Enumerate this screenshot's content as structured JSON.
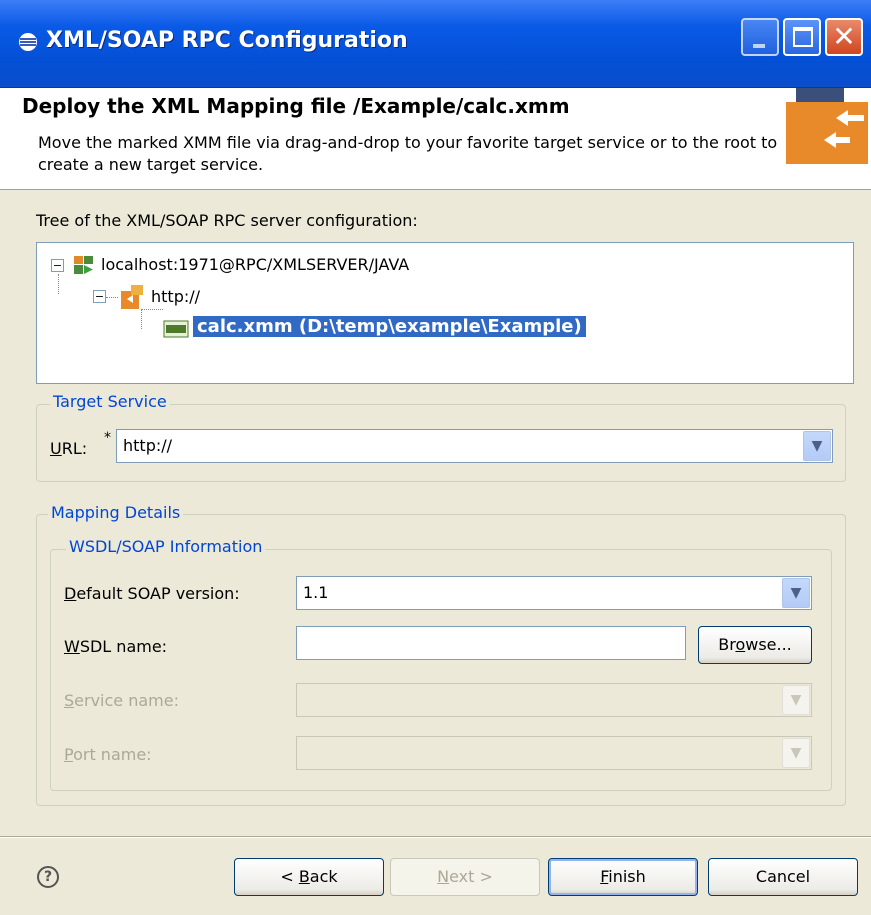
{
  "window": {
    "title": "XML/SOAP RPC Configuration"
  },
  "header": {
    "title": "Deploy the XML Mapping file /Example/calc.xmm",
    "description": "Move the marked XMM file via drag-and-drop to your favorite target service or to the root to create a new target service."
  },
  "tree": {
    "label": "Tree of the XML/SOAP RPC server configuration:",
    "root": "localhost:1971@RPC/XMLSERVER/JAVA",
    "child": "http://",
    "leaf": "calc.xmm (D:\\temp\\example\\Example)"
  },
  "target_service": {
    "group_title": "Target Service",
    "url_label": "URL:",
    "required_mark": "*",
    "url_value": "http://"
  },
  "mapping_details": {
    "group_title": "Mapping Details",
    "wsdl_group_title": "WSDL/SOAP Information",
    "soap_version_label": "Default SOAP version:",
    "soap_version_value": "1.1",
    "wsdl_name_label": "WSDL name:",
    "wsdl_name_value": "",
    "browse_label": "Browse...",
    "service_name_label": "Service name:",
    "port_name_label": "Port name:"
  },
  "footer": {
    "help_icon": "?",
    "back_label": "< Back",
    "next_label": "Next >",
    "finish_label": "Finish",
    "cancel_label": "Cancel"
  },
  "icons": {
    "title": "eclipse-icon",
    "server": "server-icon",
    "service": "service-icon",
    "file": "xmm-file-icon",
    "banner": "deploy-banner-icon"
  },
  "colors": {
    "selection": "#316ac5",
    "group_title": "#0046d5",
    "titlebar": "#0450d6"
  }
}
